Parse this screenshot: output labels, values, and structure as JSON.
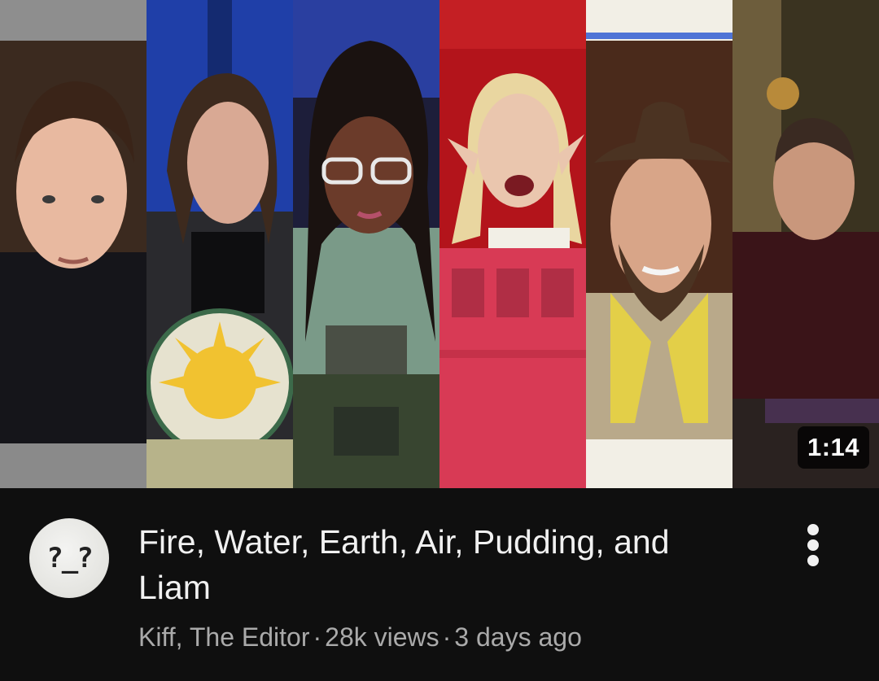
{
  "video": {
    "duration": "1:14",
    "title": "Fire, Water, Earth, Air, Pudding, and Liam",
    "channel": "Kiff, The Editor",
    "views": "28k views",
    "age": "3 days ago",
    "separator": "·"
  },
  "thumbnail": {
    "panels": [
      {
        "name": "panel-1",
        "bg": "#3b2a1f",
        "shirt": "#15151a",
        "skin": "#e8b9a0",
        "hair": "#3a2418"
      },
      {
        "name": "panel-2",
        "bg": "#1f3fa8",
        "shirt": "#2a2a2e",
        "skin": "#d9a994",
        "hair": "#3d2a1e"
      },
      {
        "name": "panel-3",
        "bg": "#1d1e3a",
        "shirt": "#7a9a88",
        "skin": "#6b3b2a",
        "hair": "#1a1210"
      },
      {
        "name": "panel-4",
        "bg": "#b3141b",
        "shirt": "#d83a55",
        "skin": "#eac6ae",
        "hair": "#e9d6a0"
      },
      {
        "name": "panel-5",
        "bg": "#4a2a1b",
        "shirt": "#b9a98a",
        "skin": "#d8a588",
        "hair": "#4b3322"
      },
      {
        "name": "panel-6",
        "bg": "#3a3320",
        "shirt": "#3a1418",
        "skin": "#c9977c",
        "hair": "#3a2a22"
      }
    ]
  },
  "avatar": {
    "icon": "confused-face-icon",
    "glyph": "?_?"
  },
  "menu": {
    "icon": "more-vertical-icon"
  }
}
